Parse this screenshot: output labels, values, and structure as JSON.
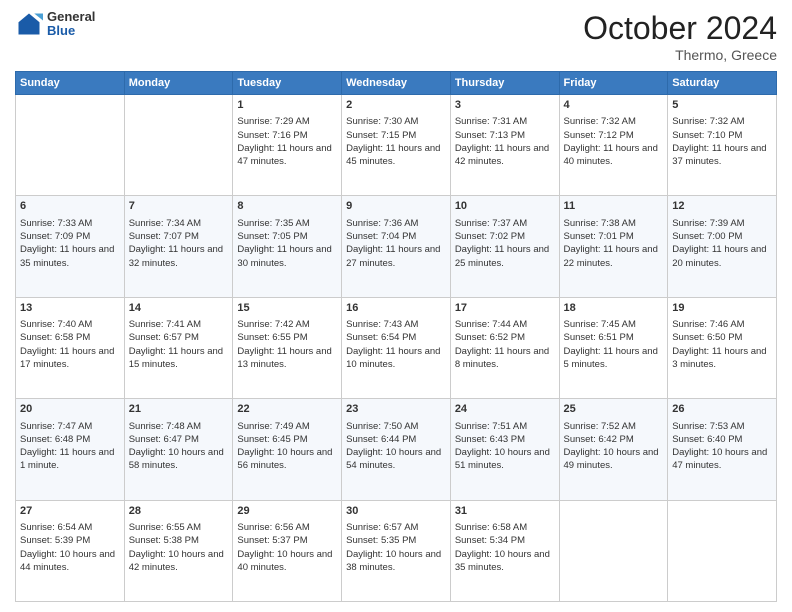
{
  "header": {
    "logo": {
      "general": "General",
      "blue": "Blue"
    },
    "title": "October 2024",
    "location": "Thermo, Greece"
  },
  "days_of_week": [
    "Sunday",
    "Monday",
    "Tuesday",
    "Wednesday",
    "Thursday",
    "Friday",
    "Saturday"
  ],
  "weeks": [
    [
      {
        "day": "",
        "sunrise": "",
        "sunset": "",
        "daylight": ""
      },
      {
        "day": "",
        "sunrise": "",
        "sunset": "",
        "daylight": ""
      },
      {
        "day": "1",
        "sunrise": "Sunrise: 7:29 AM",
        "sunset": "Sunset: 7:16 PM",
        "daylight": "Daylight: 11 hours and 47 minutes."
      },
      {
        "day": "2",
        "sunrise": "Sunrise: 7:30 AM",
        "sunset": "Sunset: 7:15 PM",
        "daylight": "Daylight: 11 hours and 45 minutes."
      },
      {
        "day": "3",
        "sunrise": "Sunrise: 7:31 AM",
        "sunset": "Sunset: 7:13 PM",
        "daylight": "Daylight: 11 hours and 42 minutes."
      },
      {
        "day": "4",
        "sunrise": "Sunrise: 7:32 AM",
        "sunset": "Sunset: 7:12 PM",
        "daylight": "Daylight: 11 hours and 40 minutes."
      },
      {
        "day": "5",
        "sunrise": "Sunrise: 7:32 AM",
        "sunset": "Sunset: 7:10 PM",
        "daylight": "Daylight: 11 hours and 37 minutes."
      }
    ],
    [
      {
        "day": "6",
        "sunrise": "Sunrise: 7:33 AM",
        "sunset": "Sunset: 7:09 PM",
        "daylight": "Daylight: 11 hours and 35 minutes."
      },
      {
        "day": "7",
        "sunrise": "Sunrise: 7:34 AM",
        "sunset": "Sunset: 7:07 PM",
        "daylight": "Daylight: 11 hours and 32 minutes."
      },
      {
        "day": "8",
        "sunrise": "Sunrise: 7:35 AM",
        "sunset": "Sunset: 7:05 PM",
        "daylight": "Daylight: 11 hours and 30 minutes."
      },
      {
        "day": "9",
        "sunrise": "Sunrise: 7:36 AM",
        "sunset": "Sunset: 7:04 PM",
        "daylight": "Daylight: 11 hours and 27 minutes."
      },
      {
        "day": "10",
        "sunrise": "Sunrise: 7:37 AM",
        "sunset": "Sunset: 7:02 PM",
        "daylight": "Daylight: 11 hours and 25 minutes."
      },
      {
        "day": "11",
        "sunrise": "Sunrise: 7:38 AM",
        "sunset": "Sunset: 7:01 PM",
        "daylight": "Daylight: 11 hours and 22 minutes."
      },
      {
        "day": "12",
        "sunrise": "Sunrise: 7:39 AM",
        "sunset": "Sunset: 7:00 PM",
        "daylight": "Daylight: 11 hours and 20 minutes."
      }
    ],
    [
      {
        "day": "13",
        "sunrise": "Sunrise: 7:40 AM",
        "sunset": "Sunset: 6:58 PM",
        "daylight": "Daylight: 11 hours and 17 minutes."
      },
      {
        "day": "14",
        "sunrise": "Sunrise: 7:41 AM",
        "sunset": "Sunset: 6:57 PM",
        "daylight": "Daylight: 11 hours and 15 minutes."
      },
      {
        "day": "15",
        "sunrise": "Sunrise: 7:42 AM",
        "sunset": "Sunset: 6:55 PM",
        "daylight": "Daylight: 11 hours and 13 minutes."
      },
      {
        "day": "16",
        "sunrise": "Sunrise: 7:43 AM",
        "sunset": "Sunset: 6:54 PM",
        "daylight": "Daylight: 11 hours and 10 minutes."
      },
      {
        "day": "17",
        "sunrise": "Sunrise: 7:44 AM",
        "sunset": "Sunset: 6:52 PM",
        "daylight": "Daylight: 11 hours and 8 minutes."
      },
      {
        "day": "18",
        "sunrise": "Sunrise: 7:45 AM",
        "sunset": "Sunset: 6:51 PM",
        "daylight": "Daylight: 11 hours and 5 minutes."
      },
      {
        "day": "19",
        "sunrise": "Sunrise: 7:46 AM",
        "sunset": "Sunset: 6:50 PM",
        "daylight": "Daylight: 11 hours and 3 minutes."
      }
    ],
    [
      {
        "day": "20",
        "sunrise": "Sunrise: 7:47 AM",
        "sunset": "Sunset: 6:48 PM",
        "daylight": "Daylight: 11 hours and 1 minute."
      },
      {
        "day": "21",
        "sunrise": "Sunrise: 7:48 AM",
        "sunset": "Sunset: 6:47 PM",
        "daylight": "Daylight: 10 hours and 58 minutes."
      },
      {
        "day": "22",
        "sunrise": "Sunrise: 7:49 AM",
        "sunset": "Sunset: 6:45 PM",
        "daylight": "Daylight: 10 hours and 56 minutes."
      },
      {
        "day": "23",
        "sunrise": "Sunrise: 7:50 AM",
        "sunset": "Sunset: 6:44 PM",
        "daylight": "Daylight: 10 hours and 54 minutes."
      },
      {
        "day": "24",
        "sunrise": "Sunrise: 7:51 AM",
        "sunset": "Sunset: 6:43 PM",
        "daylight": "Daylight: 10 hours and 51 minutes."
      },
      {
        "day": "25",
        "sunrise": "Sunrise: 7:52 AM",
        "sunset": "Sunset: 6:42 PM",
        "daylight": "Daylight: 10 hours and 49 minutes."
      },
      {
        "day": "26",
        "sunrise": "Sunrise: 7:53 AM",
        "sunset": "Sunset: 6:40 PM",
        "daylight": "Daylight: 10 hours and 47 minutes."
      }
    ],
    [
      {
        "day": "27",
        "sunrise": "Sunrise: 6:54 AM",
        "sunset": "Sunset: 5:39 PM",
        "daylight": "Daylight: 10 hours and 44 minutes."
      },
      {
        "day": "28",
        "sunrise": "Sunrise: 6:55 AM",
        "sunset": "Sunset: 5:38 PM",
        "daylight": "Daylight: 10 hours and 42 minutes."
      },
      {
        "day": "29",
        "sunrise": "Sunrise: 6:56 AM",
        "sunset": "Sunset: 5:37 PM",
        "daylight": "Daylight: 10 hours and 40 minutes."
      },
      {
        "day": "30",
        "sunrise": "Sunrise: 6:57 AM",
        "sunset": "Sunset: 5:35 PM",
        "daylight": "Daylight: 10 hours and 38 minutes."
      },
      {
        "day": "31",
        "sunrise": "Sunrise: 6:58 AM",
        "sunset": "Sunset: 5:34 PM",
        "daylight": "Daylight: 10 hours and 35 minutes."
      },
      {
        "day": "",
        "sunrise": "",
        "sunset": "",
        "daylight": ""
      },
      {
        "day": "",
        "sunrise": "",
        "sunset": "",
        "daylight": ""
      }
    ]
  ]
}
